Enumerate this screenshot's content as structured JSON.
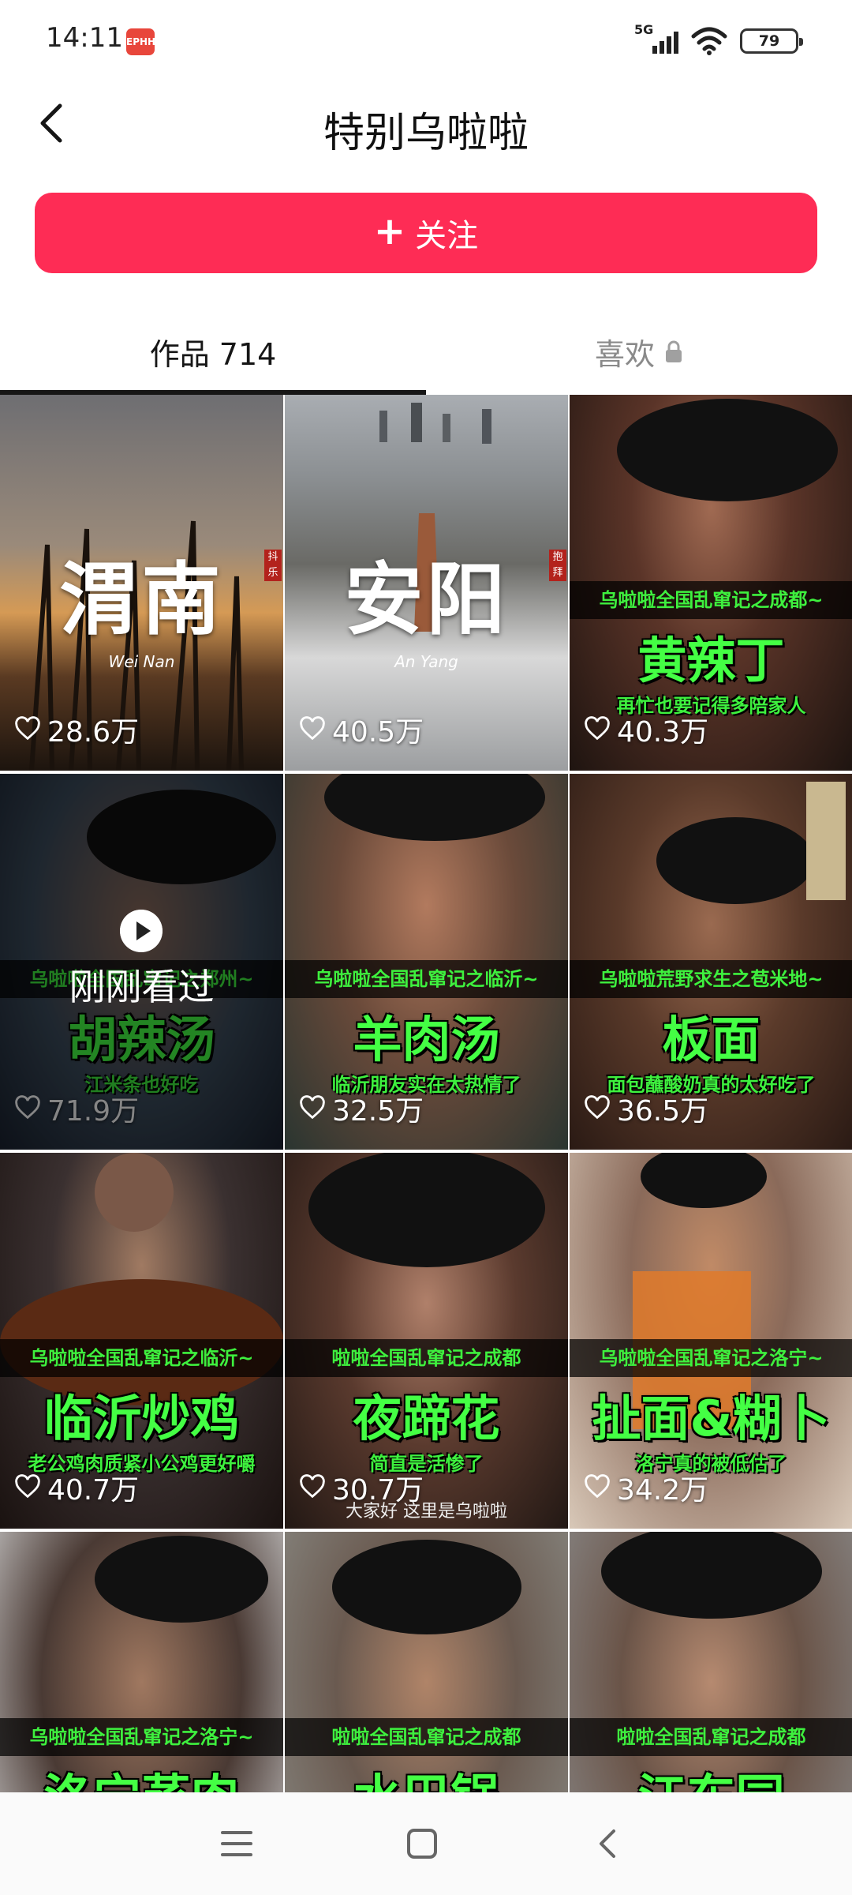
{
  "status_bar": {
    "time": "14:11",
    "app_icon_text": "EPHH",
    "network": "5G",
    "battery": "79"
  },
  "header": {
    "title": "特别乌啦啦",
    "back_icon": "chevron-left-icon"
  },
  "follow_button": {
    "icon": "plus-icon",
    "label": "关注",
    "color": "#fe2c55"
  },
  "tabs": [
    {
      "label": "作品 714",
      "active": true
    },
    {
      "label": "喜欢",
      "active": false,
      "icon": "lock-icon"
    }
  ],
  "videos": [
    {
      "title": "渭南",
      "subtitle": "Wei Nan",
      "stamp": "抖乐",
      "likes": "28.6万"
    },
    {
      "title": "安阳",
      "subtitle": "An Yang",
      "stamp": "抱拜",
      "likes": "40.5万"
    },
    {
      "series": "乌啦啦全国乱窜记之成都~",
      "dish": "黄辣丁",
      "caption": "再忙也要记得多陪家人",
      "likes": "40.3万"
    },
    {
      "series": "乌啦啦全国乱窜记之郑州~",
      "dish": "胡辣汤",
      "caption": "江米条也好吃",
      "likes": "71.9万",
      "viewed_label": "刚刚看过"
    },
    {
      "series": "乌啦啦全国乱窜记之临沂~",
      "dish": "羊肉汤",
      "caption": "临沂朋友实在太热情了",
      "likes": "32.5万"
    },
    {
      "series": "乌啦啦荒野求生之苞米地~",
      "dish": "板面",
      "caption": "面包蘸酸奶真的太好吃了",
      "likes": "36.5万"
    },
    {
      "series": "乌啦啦全国乱窜记之临沂~",
      "dish": "临沂炒鸡",
      "caption": "老公鸡肉质紧小公鸡更好嚼",
      "likes": "40.7万"
    },
    {
      "series": "啦啦全国乱窜记之成都",
      "dish": "夜蹄花",
      "caption": "简直是活惨了",
      "likes": "30.7万",
      "subtitle_line": "大家好 这里是乌啦啦"
    },
    {
      "series": "乌啦啦全国乱窜记之洛宁~",
      "dish": "扯面&糊卜",
      "caption": "洛宁真的被低估了",
      "likes": "34.2万"
    },
    {
      "series": "乌啦啦全国乱窜记之洛宁~",
      "dish": "洛宁蒸肉"
    },
    {
      "series": "啦啦全国乱窜记之成都",
      "dish": "水巴锅"
    },
    {
      "series": "啦啦全国乱窜记之成都",
      "dish": "江东园"
    }
  ],
  "nav_bar": {
    "buttons": [
      "menu-icon",
      "home-icon",
      "back-icon"
    ]
  }
}
